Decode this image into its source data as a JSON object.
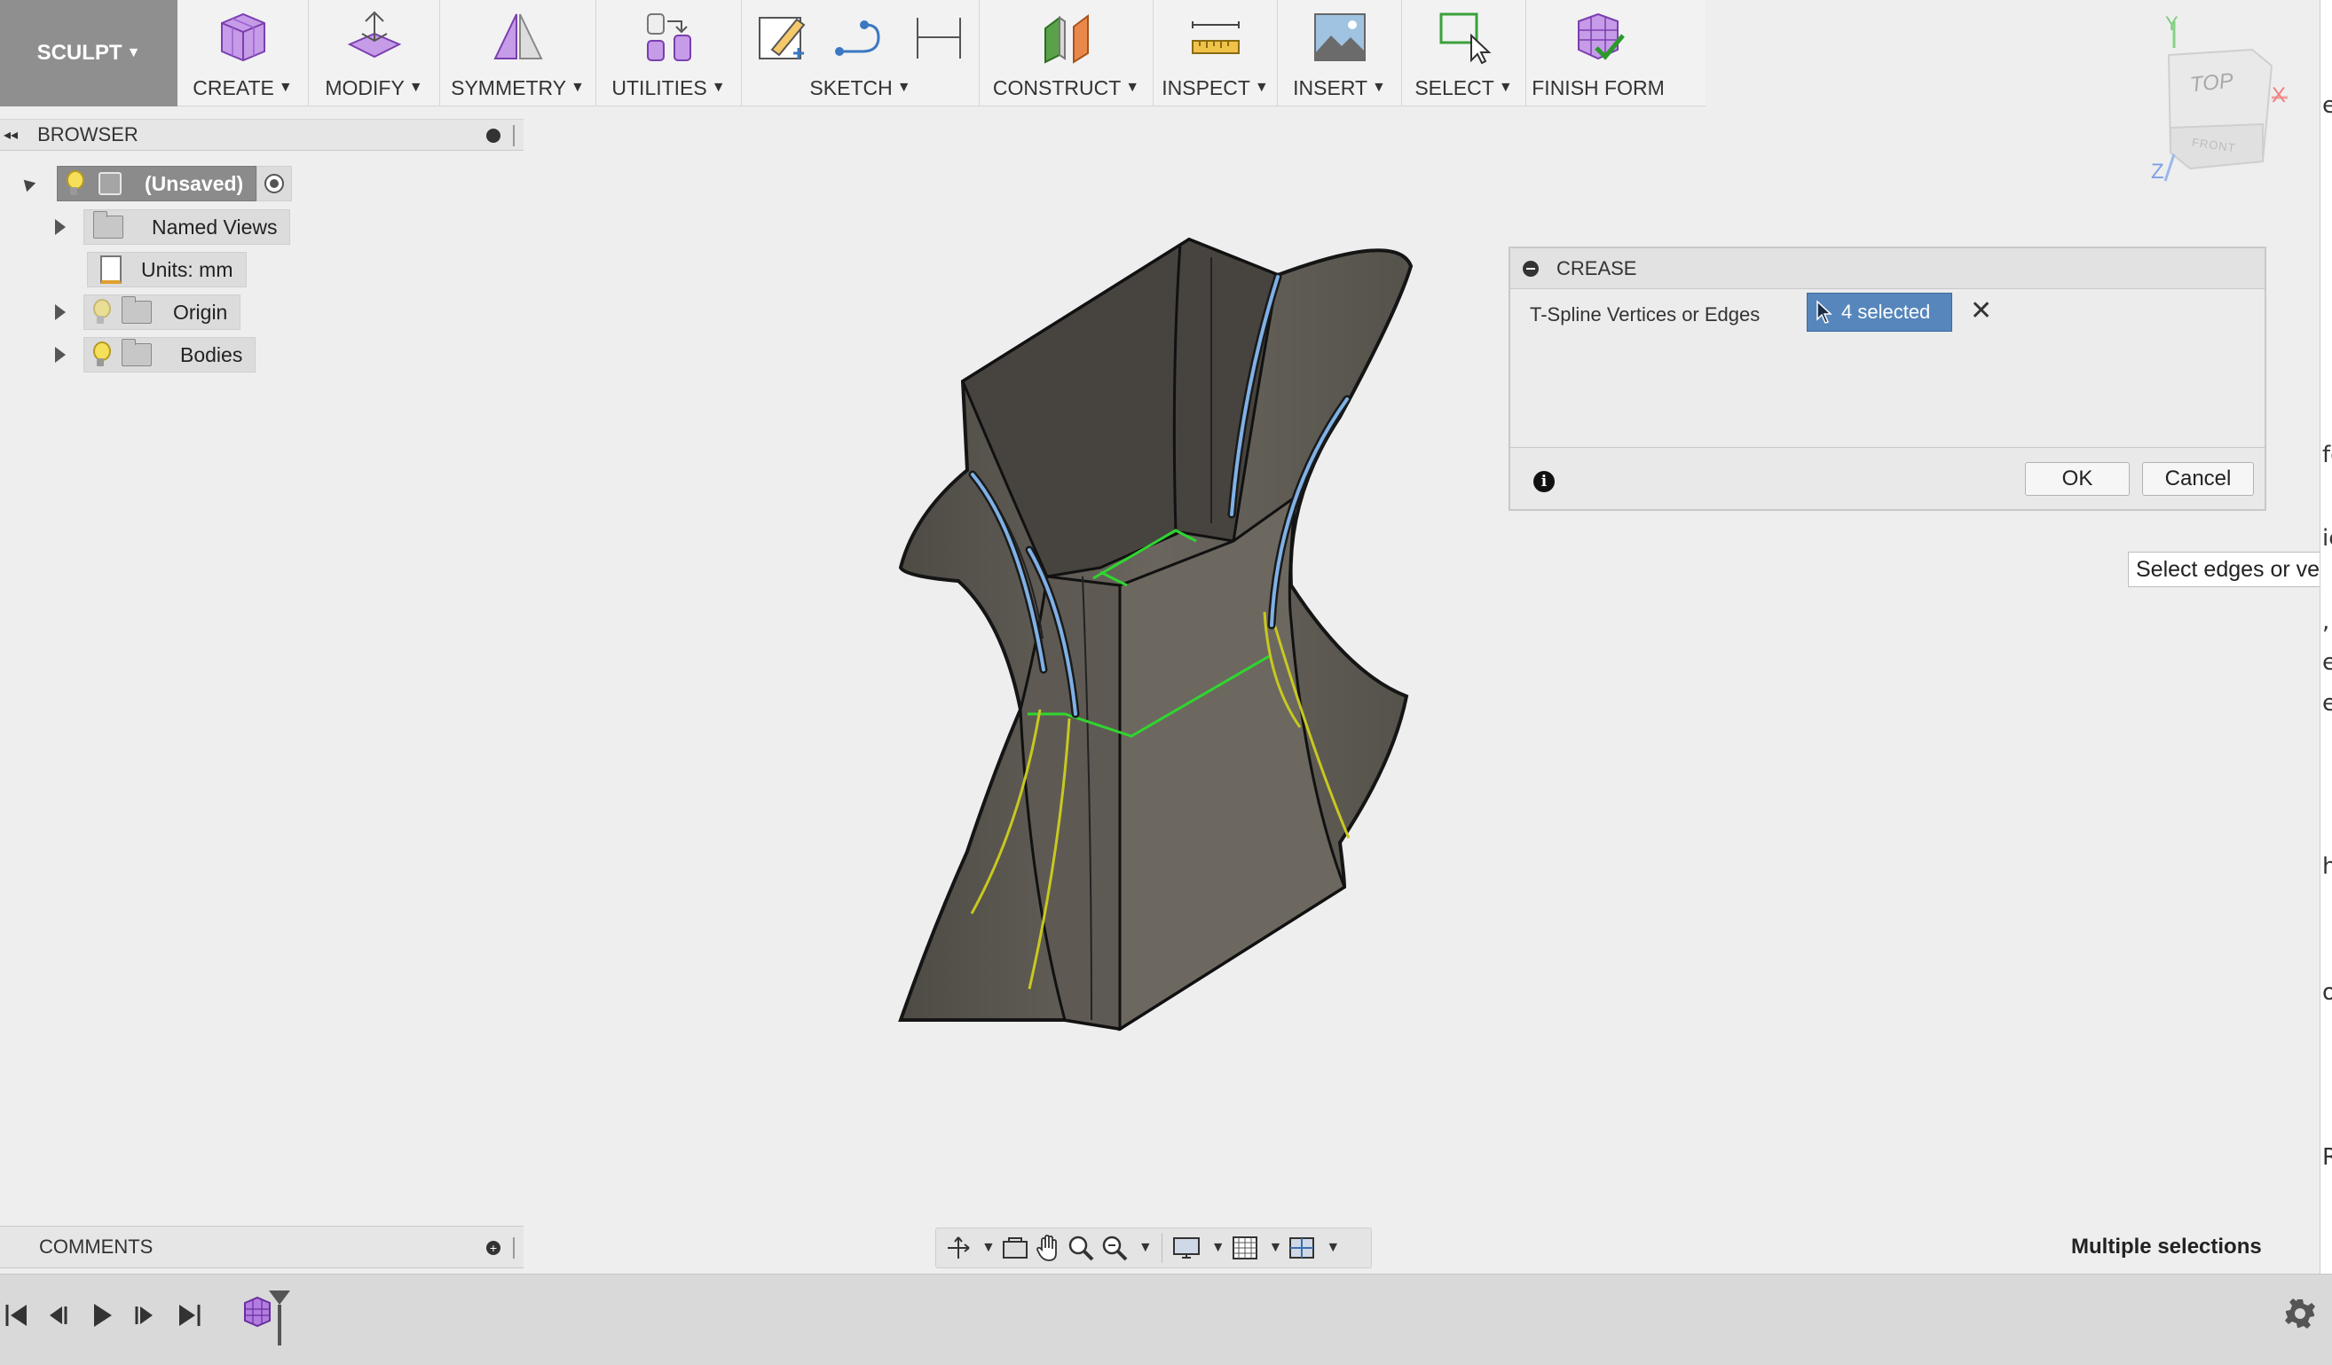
{
  "toolbar": {
    "workspace": "SCULPT",
    "groups": [
      {
        "label": "CREATE",
        "icon": "box-icon"
      },
      {
        "label": "MODIFY",
        "icon": "modify-icon"
      },
      {
        "label": "SYMMETRY",
        "icon": "symmetry-icon"
      },
      {
        "label": "UTILITIES",
        "icon": "utilities-icon"
      },
      {
        "label": "SKETCH",
        "icon": "sketch-icon"
      },
      {
        "label": "CONSTRUCT",
        "icon": "construct-icon"
      },
      {
        "label": "INSPECT",
        "icon": "measure-icon"
      },
      {
        "label": "INSERT",
        "icon": "insert-image-icon"
      },
      {
        "label": "SELECT",
        "icon": "select-icon"
      },
      {
        "label": "FINISH FORM",
        "icon": "finish-form-icon"
      }
    ]
  },
  "browser": {
    "title": "BROWSER",
    "root": "(Unsaved)",
    "items": [
      {
        "label": "Named Views"
      },
      {
        "label": "Units: mm"
      },
      {
        "label": "Origin"
      },
      {
        "label": "Bodies"
      }
    ]
  },
  "viewcube": {
    "top": "TOP",
    "front": "FRONT",
    "axis_x": "X",
    "axis_y": "Y",
    "axis_z": "Z"
  },
  "dialog": {
    "title": "CREASE",
    "field_label": "T-Spline Vertices or Edges",
    "selection": "4 selected",
    "ok": "OK",
    "cancel": "Cancel"
  },
  "tooltip": {
    "text": "Select edges or ve"
  },
  "right_edge_chars": [
    "e",
    "fo",
    "ic",
    ",",
    "e",
    "e",
    "h",
    "ol",
    "R"
  ],
  "comments": {
    "title": "COMMENTS"
  },
  "status": {
    "text": "Multiple selections"
  },
  "colors": {
    "model": "#5f5c55",
    "selected_edge": "#7fb1e6",
    "crease_edge": "#c8c820",
    "symmetry_edge": "#2fd62f",
    "selection_chip": "#5686bb"
  }
}
